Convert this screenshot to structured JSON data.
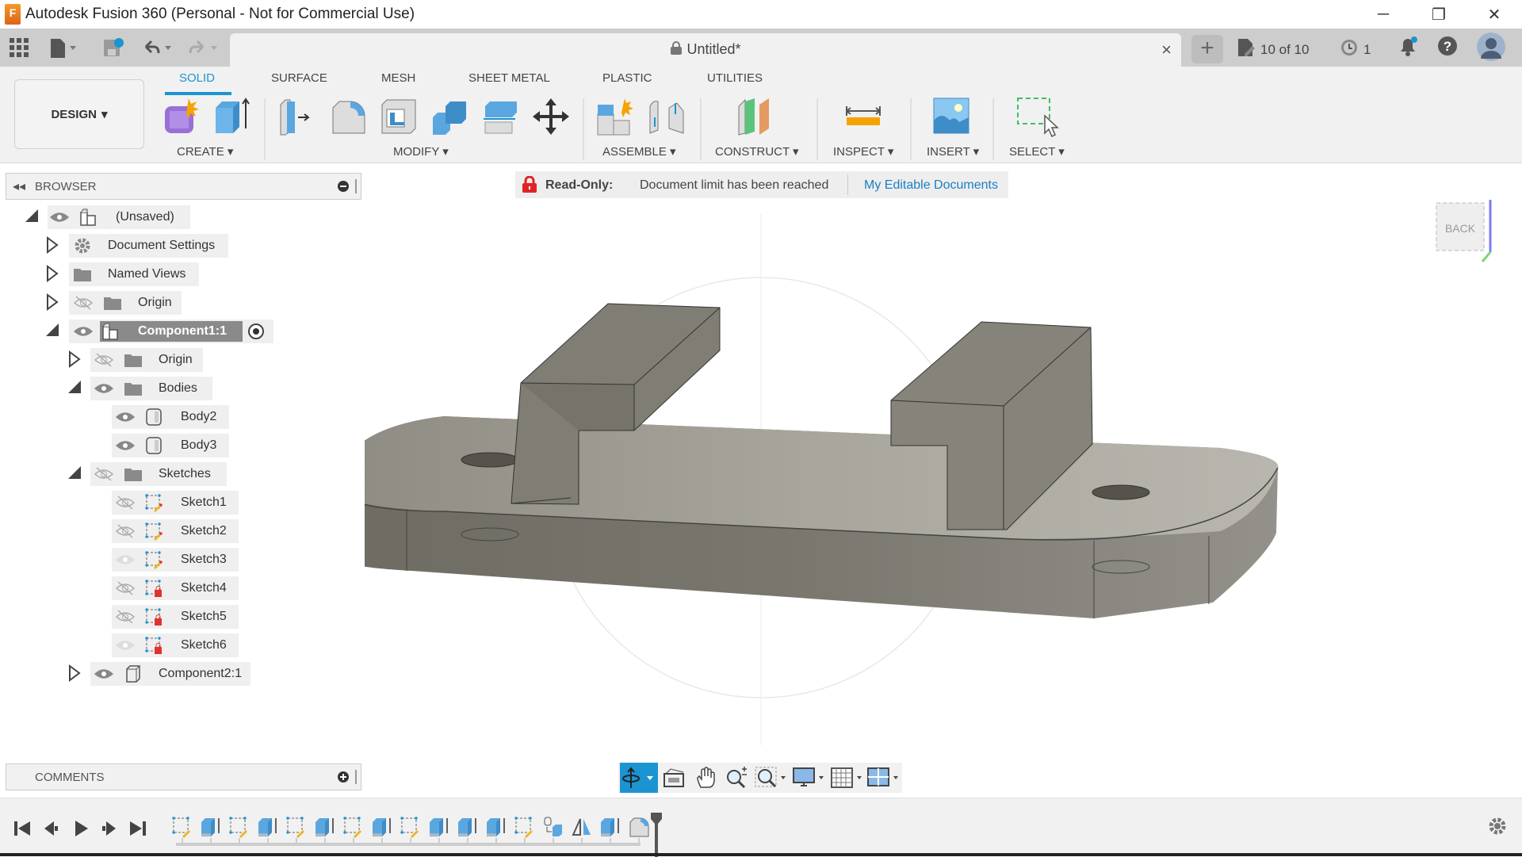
{
  "window": {
    "title": "Autodesk Fusion 360 (Personal - Not for Commercial Use)",
    "controls": {
      "minimize": "─",
      "restore": "❐",
      "close": "✕"
    }
  },
  "tabbar": {
    "document_title": "Untitled*",
    "close_glyph": "×",
    "new_tab_glyph": "+",
    "job_status": "10 of 10",
    "recent_count": "1",
    "notification_dot_color": "#1b94d2"
  },
  "ribbon": {
    "workspace": "DESIGN",
    "tabs": [
      {
        "label": "SOLID",
        "active": true
      },
      {
        "label": "SURFACE",
        "active": false
      },
      {
        "label": "MESH",
        "active": false
      },
      {
        "label": "SHEET METAL",
        "active": false
      },
      {
        "label": "PLASTIC",
        "active": false
      },
      {
        "label": "UTILITIES",
        "active": false
      }
    ],
    "groups": [
      {
        "label": "CREATE ▾"
      },
      {
        "label": "MODIFY ▾"
      },
      {
        "label": "ASSEMBLE ▾"
      },
      {
        "label": "CONSTRUCT ▾"
      },
      {
        "label": "INSPECT ▾"
      },
      {
        "label": "INSERT ▾"
      },
      {
        "label": "SELECT ▾"
      }
    ],
    "accent": "#1b94d2"
  },
  "browser": {
    "title": "BROWSER",
    "tree": [
      {
        "label": "(Unsaved)"
      },
      {
        "label": "Document Settings"
      },
      {
        "label": "Named Views"
      },
      {
        "label": "Origin"
      },
      {
        "label": "Component1:1"
      },
      {
        "label": "Origin"
      },
      {
        "label": "Bodies"
      },
      {
        "label": "Body2"
      },
      {
        "label": "Body3"
      },
      {
        "label": "Sketches"
      },
      {
        "label": "Sketch1"
      },
      {
        "label": "Sketch2"
      },
      {
        "label": "Sketch3"
      },
      {
        "label": "Sketch4"
      },
      {
        "label": "Sketch5"
      },
      {
        "label": "Sketch6"
      },
      {
        "label": "Component2:1"
      }
    ]
  },
  "banner": {
    "label": "Read-Only:",
    "message": "Document limit has been reached",
    "link": "My Editable Documents",
    "lock_color": "#e02424",
    "link_color": "#1b7fc4"
  },
  "viewcube": {
    "face": "BACK",
    "axis": "Z"
  },
  "comments": {
    "title": "COMMENTS"
  }
}
